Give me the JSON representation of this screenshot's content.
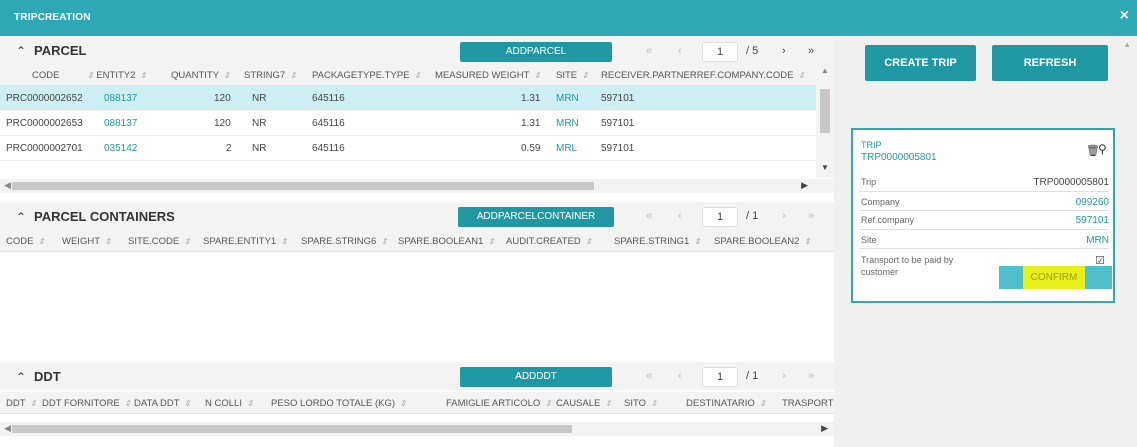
{
  "window": {
    "title": "TRIPCREATION",
    "close_glyph": "×"
  },
  "parcel": {
    "title": "PARCEL",
    "add_label": "ADDPARCEL",
    "pager": {
      "first": "«",
      "prev": "‹",
      "page": "1",
      "of": "/ 5",
      "next": "›",
      "last": "»"
    },
    "columns": [
      "CODE",
      "ENTITY2",
      "QUANTITY",
      "STRING7",
      "PACKAGETYPE.TYPE",
      "MEASURED WEIGHT",
      "SITE",
      "RECEIVER.PARTNERREF.COMPANY.CODE"
    ],
    "rows": [
      {
        "code": "PRC0000002652",
        "entity2": "088137",
        "quantity": "120",
        "string7": "NR",
        "packagetype": "645116",
        "weight": "1.31",
        "site": "MRN",
        "receiver": "597101",
        "selected": true
      },
      {
        "code": "PRC0000002653",
        "entity2": "088137",
        "quantity": "120",
        "string7": "NR",
        "packagetype": "645116",
        "weight": "1.31",
        "site": "MRN",
        "receiver": "597101",
        "selected": false
      },
      {
        "code": "PRC0000002701",
        "entity2": "035142",
        "quantity": "2",
        "string7": "NR",
        "packagetype": "645116",
        "weight": "0.59",
        "site": "MRL",
        "receiver": "597101",
        "selected": false
      }
    ]
  },
  "containers": {
    "title": "PARCEL CONTAINERS",
    "add_label": "ADDPARCELCONTAINER",
    "pager": {
      "first": "«",
      "prev": "‹",
      "page": "1",
      "of": "/ 1",
      "next": "›",
      "last": "»"
    },
    "columns": [
      "CODE",
      "WEIGHT",
      "SITE.CODE",
      "SPARE.ENTITY1",
      "SPARE.STRING6",
      "SPARE.BOOLEAN1",
      "AUDIT.CREATED",
      "SPARE.STRING1",
      "SPARE.BOOLEAN2"
    ]
  },
  "ddt": {
    "title": "DDT",
    "add_label": "ADDDDT",
    "pager": {
      "first": "«",
      "prev": "‹",
      "page": "1",
      "of": "/ 1",
      "next": "›",
      "last": "»"
    },
    "columns": [
      "DDT",
      "DDT FORNITORE",
      "DATA DDT",
      "N COLLI",
      "PESO LORDO TOTALE (KG)",
      "FAMIGLIE ARTICOLO",
      "CAUSALE",
      "SITO",
      "DESTINATARIO",
      "TRASPORT"
    ]
  },
  "actions": {
    "create_trip": "CREATE TRIP",
    "refresh": "REFRESH"
  },
  "trip_card": {
    "header_label": "TRIP",
    "header_code": "TRP0000005801",
    "fields": [
      {
        "label": "Trip",
        "value": "TRP0000005801"
      },
      {
        "label": "Company",
        "value": "099260"
      },
      {
        "label": "Ref.company",
        "value": "597101"
      },
      {
        "label": "Site",
        "value": "MRN"
      },
      {
        "label": "Transport to be paid by customer",
        "value": "☑"
      }
    ],
    "confirm_label": "CONFIRM"
  },
  "colors": {
    "accent": "#2ea8b5",
    "button": "#1f98a4",
    "selected_row": "#cdeef2",
    "highlight": "#e8ef1a"
  },
  "icons": [
    "close-icon",
    "chevron-up-icon",
    "sort-icon",
    "trash-icon",
    "search-icon",
    "checkbox-checked-icon",
    "scroll-left-icon",
    "scroll-right-icon",
    "scroll-down-icon"
  ]
}
